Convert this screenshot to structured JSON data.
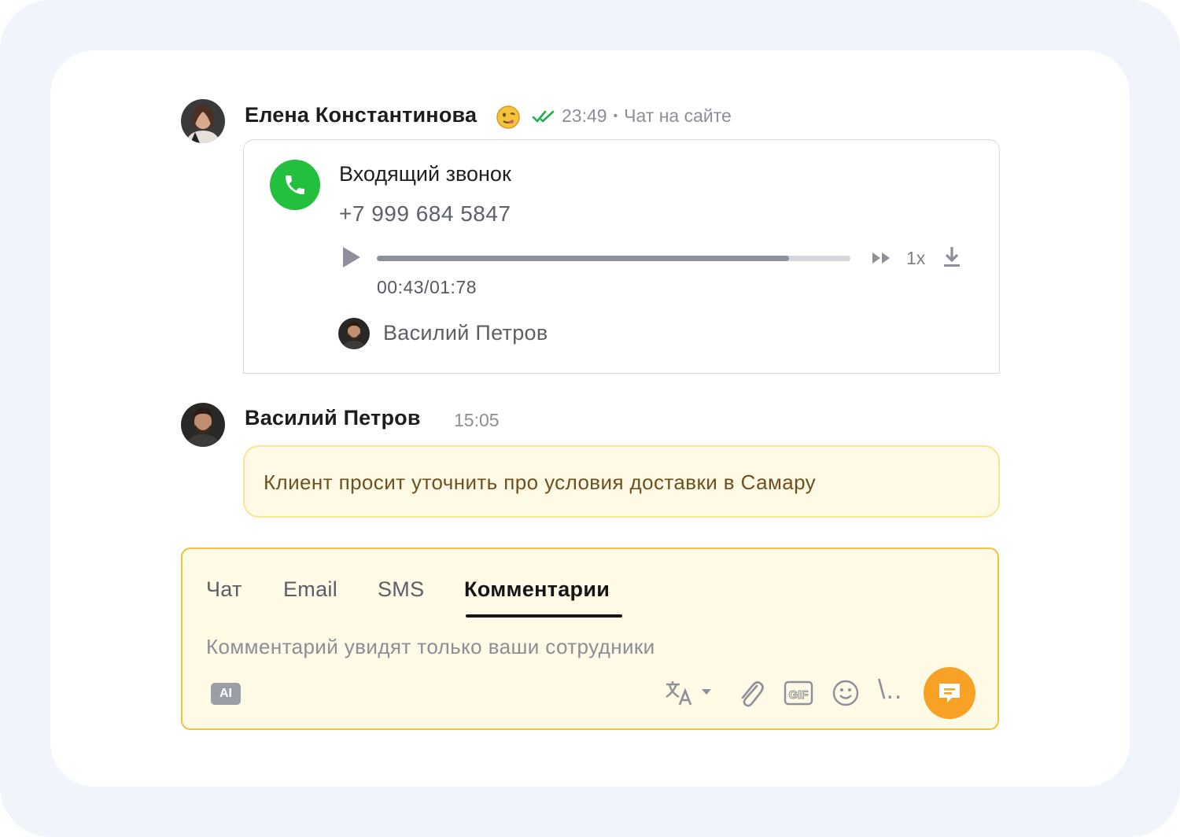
{
  "messages": [
    {
      "author": "Елена Константинова",
      "emoji": "🫠",
      "status": "read",
      "time": "23:49",
      "separator": "•",
      "channel": "Чат на сайте",
      "call": {
        "title": "Входящий звонок",
        "phone": "+7 999 684 5847",
        "progress": 0.87,
        "time": "00:43/01:78",
        "speed": "1x",
        "operator": "Василий Петров"
      }
    },
    {
      "author": "Василий Петров",
      "time": "15:05",
      "note": "Клиент просит уточнить про условия доставки в Самару"
    }
  ],
  "composer": {
    "tabs": [
      "Чат",
      "Email",
      "SMS",
      "Комментарии"
    ],
    "active_tab": "Комментарии",
    "placeholder": "Комментарий увидят только ваши сотрудники",
    "ai_label": "AI",
    "gif_label": "GIF",
    "snippets_label": "\\..",
    "send_color": "#f7a224",
    "accent_color": "#f1c23e"
  },
  "icons": [
    "avatar",
    "emoji-icon",
    "double-check-icon",
    "phone-icon",
    "play-icon",
    "fast-forward-icon",
    "download-icon",
    "translate-icon",
    "chevron-down-icon",
    "attach-icon",
    "gif-icon",
    "smile-icon",
    "send-comment-icon"
  ]
}
